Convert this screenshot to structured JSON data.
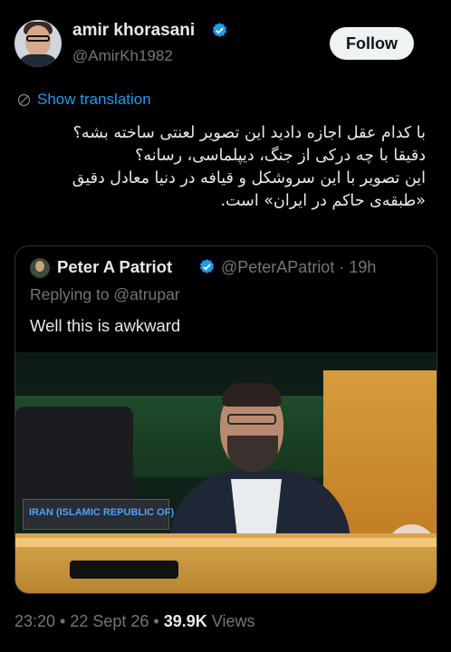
{
  "author": {
    "name": "amir khorasani",
    "handle": "@AmirKh1982",
    "verified": true,
    "avatar_icon": "profile-photo"
  },
  "follow_label": "Follow",
  "translate_label": "Show translation",
  "body_lines": [
    "با کدام عقل اجازه دادید این تصویر لعنتی ساخته بشه؟",
    "دقیقا با چه درکی از جنگ، دیپلماسی، رسانه؟",
    "این تصویر با این سروشکل و قیافه در دنیا معادل دقیق",
    "«طبقه‌ی حاکم در ایران» است."
  ],
  "quote": {
    "name": "Peter A Patriot",
    "handle": "@PeterAPatriot",
    "time": "19h",
    "handle_time": "@PeterAPatriot · 19h",
    "replying_to": "Replying to @atrupar",
    "text": "Well this is awkward",
    "image_nameplate": "IRAN (ISLAMIC REPUBLIC OF)"
  },
  "meta": {
    "time_date": "23:20 • 22 Sept 26 • ",
    "views_count": "39.9K",
    "views_label": " Views"
  },
  "colors": {
    "background": "#000000",
    "accent": "#1d9bf0",
    "muted": "#71767b",
    "text": "#e7e9ea"
  }
}
